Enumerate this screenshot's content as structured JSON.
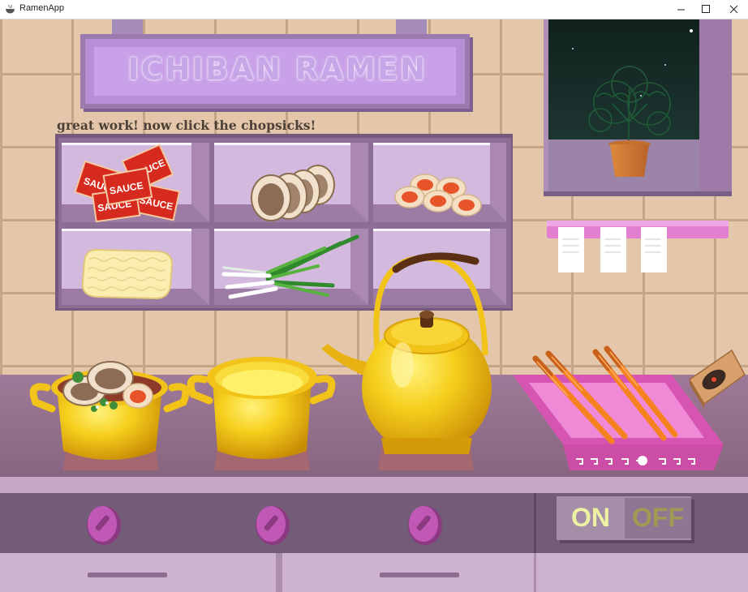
{
  "window": {
    "title": "RamenApp",
    "app_icon": "ramen-bowl-icon",
    "minimize_glyph": "—",
    "maximize_glyph": "☐",
    "close_glyph": "✕"
  },
  "sign": {
    "title": "ICHIBAN RAMEN"
  },
  "hint": {
    "text": "great work! now click the chopsicks!"
  },
  "shelf": {
    "items": [
      {
        "name": "sauce-packets",
        "label": "SAUCE"
      },
      {
        "name": "chashu-pork"
      },
      {
        "name": "ramen-eggs"
      },
      {
        "name": "dried-noodle-block"
      },
      {
        "name": "green-onions"
      },
      {
        "name": "empty-slot"
      }
    ]
  },
  "stove": {
    "toggle": {
      "on_label": "ON",
      "off_label": "OFF",
      "state": "on"
    },
    "pots": [
      "ramen-bowl-pot",
      "empty-pot",
      "tea-kettle"
    ],
    "knob_count": 3
  },
  "colors": {
    "wall": "#e4c7aa",
    "grout": "#c6a586",
    "shelf": "#8c6d94",
    "counter": "#95708f",
    "cabinet": "#cdb3d0",
    "gold": "#f2c319",
    "tray": "#e468c0",
    "chopsticks": "#f5821e",
    "sign": "#c8a1e8",
    "toggle_on": "#ecf2a2"
  }
}
